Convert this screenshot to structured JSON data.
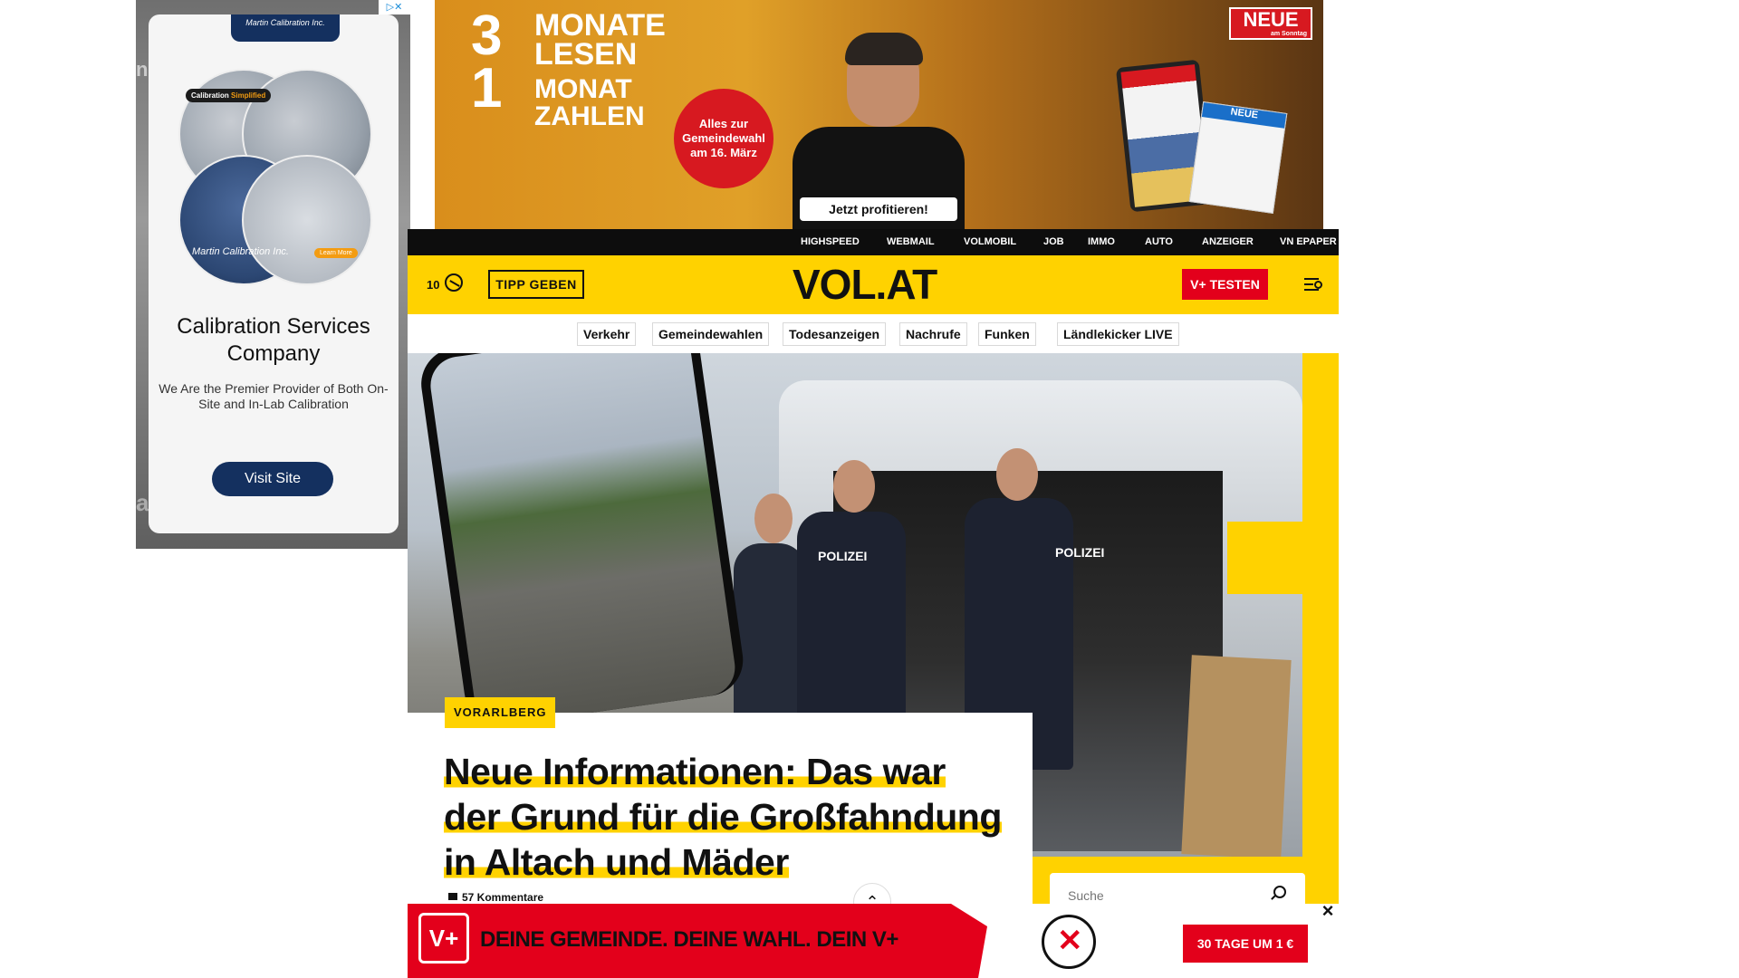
{
  "side_ad": {
    "company_pill": "Martin Calibration Inc.",
    "circle_label_prefix": "Calibration",
    "circle_label_suffix": "Simplified",
    "circle_caption": "Martin Calibration Inc.",
    "learn_more": "Learn More",
    "headline": "Calibration Services Company",
    "subtext": "We Are the Premier Provider of Both On-Site and In-Lab Calibration",
    "cta": "Visit Site",
    "bg_text_top": "n",
    "bg_text_bottom": "alibra"
  },
  "top_ad": {
    "line1_big": "3",
    "line1_small": "MONATE LESEN",
    "line2_big": "1",
    "line2_small": "MONAT ZAHLEN",
    "badge": "Alles zur Gemeindewahl am 16. März",
    "cta": "Jetzt profitieren!",
    "brand": "NEUE",
    "brand_sub": "am Sonntag",
    "paper_mast": "NEUE"
  },
  "service_nav": [
    "HIGHSPEED",
    "WEBMAIL",
    "VOLMOBIL",
    "JOB",
    "IMMO",
    "AUTO",
    "ANZEIGER",
    "VN EPAPER"
  ],
  "header": {
    "temperature": "10",
    "tipp_button": "TIPP GEBEN",
    "logo": "VOL.AT",
    "vplus_button": "V+ TESTEN"
  },
  "topics": [
    "Verkehr",
    "Gemeindewahlen",
    "Todesanzeigen",
    "Nachrufe",
    "Funken",
    "Ländlekicker LIVE"
  ],
  "article": {
    "category": "VORARLBERG",
    "headline_lines": [
      "Neue Informationen: Das war",
      "der Grund für die Großfahndung",
      "in Altach und Mäder"
    ],
    "comments": "57 Kommentare",
    "image_text_1": "POLIZEI",
    "image_text_2": "POLIZEI"
  },
  "search": {
    "placeholder": "Suche"
  },
  "bottom_banner": {
    "vplus": "V+",
    "text": "DEINE GEMEINDE. DEINE WAHL. DEIN V+",
    "cta": "30 TAGE UM 1 €",
    "close": "×"
  },
  "colors": {
    "brand_yellow": "#ffd200",
    "brand_red": "#e3001b",
    "nav_black": "#0d0d0d",
    "ad_navy": "#14305f"
  }
}
